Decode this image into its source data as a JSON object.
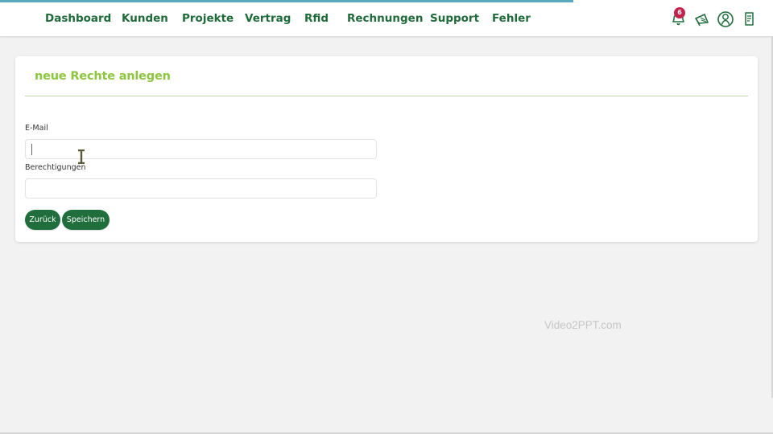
{
  "nav": {
    "items": [
      {
        "label": "Dashboard"
      },
      {
        "label": "Kunden"
      },
      {
        "label": "Projekte"
      },
      {
        "label": "Vertrag"
      },
      {
        "label": "Rfid"
      },
      {
        "label": "Rechnungen"
      },
      {
        "label": "Support"
      },
      {
        "label": "Fehler"
      }
    ]
  },
  "header_icons": {
    "notifications": {
      "icon": "bell-icon",
      "badge": "6"
    },
    "announcements": {
      "icon": "megaphone-icon"
    },
    "profile": {
      "icon": "user-circle-icon"
    },
    "tickets": {
      "icon": "document-icon"
    }
  },
  "form": {
    "title": "neue Rechte anlegen",
    "email": {
      "label": "E-Mail",
      "value": "",
      "placeholder": ""
    },
    "permissions": {
      "label": "Berechtigungen",
      "value": "",
      "placeholder": ""
    },
    "back_label": "Zurück",
    "save_label": "Speichern"
  },
  "watermark": "Video2PPT.com",
  "colors": {
    "brand_green": "#1f6e3c",
    "title_green": "#8cc63f",
    "badge_red": "#c2224b",
    "progress_blue": "#5aa9bf"
  }
}
